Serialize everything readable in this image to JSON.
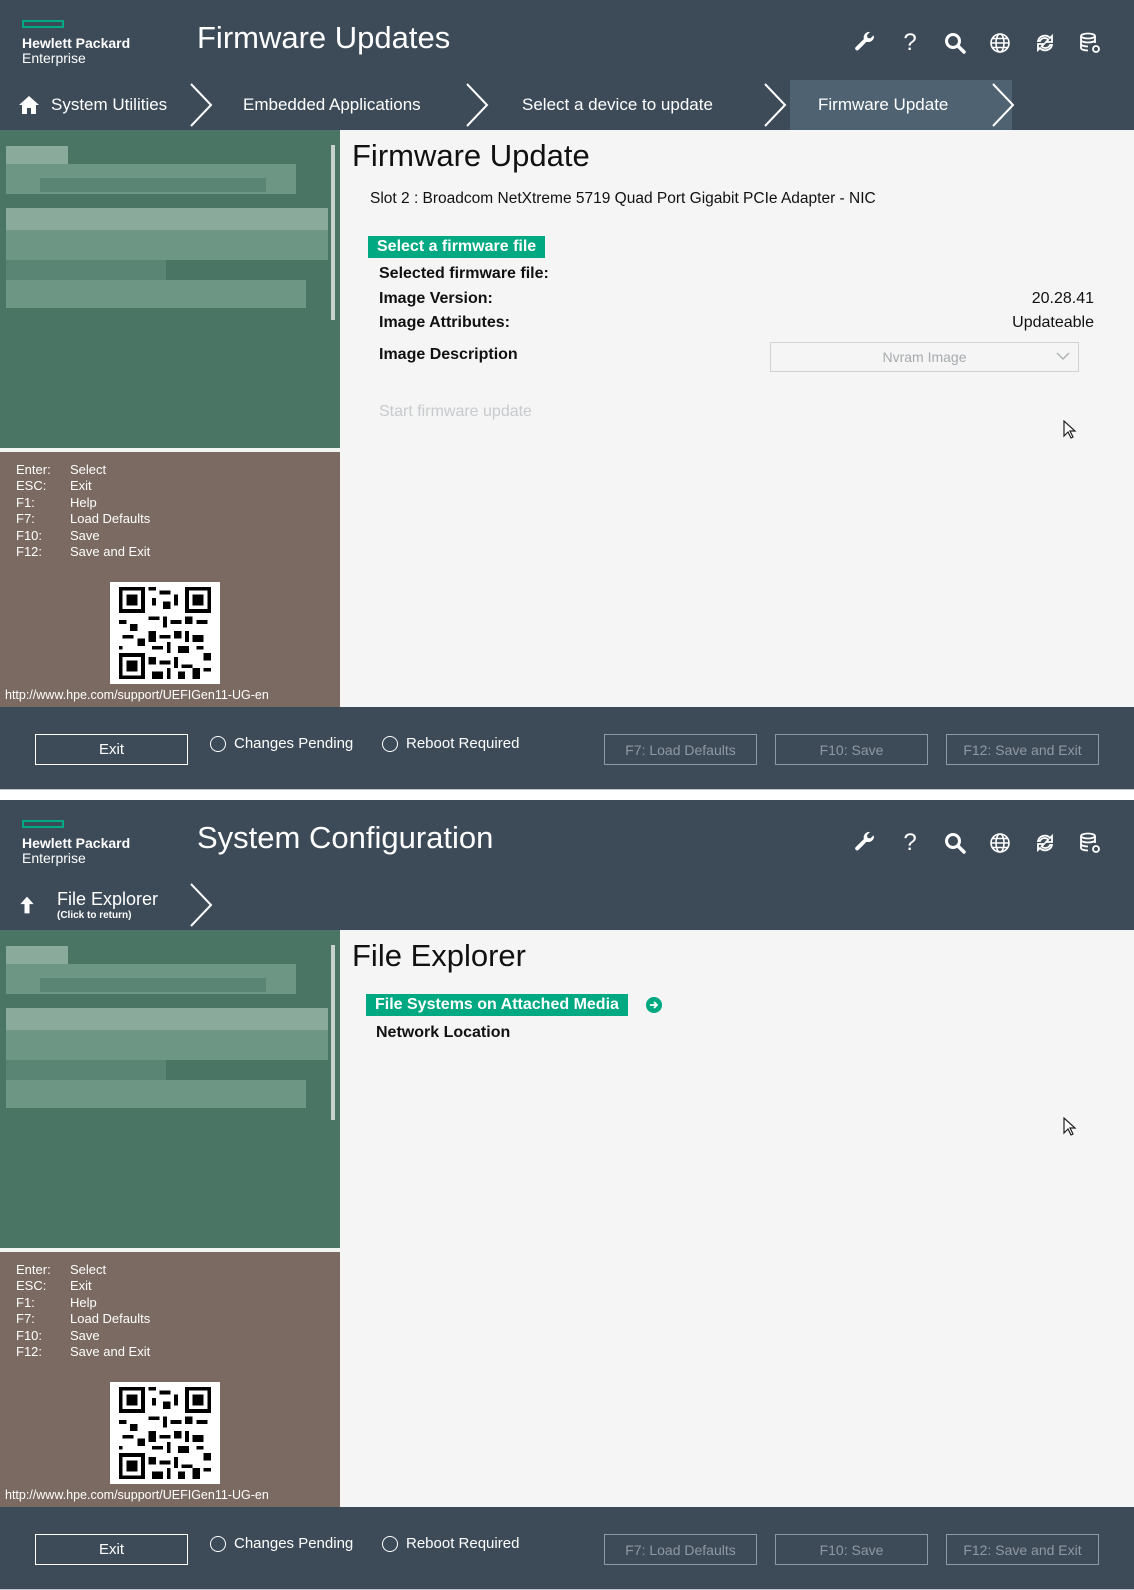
{
  "brand": {
    "line1": "Hewlett Packard",
    "line2": "Enterprise"
  },
  "colors": {
    "header": "#3d4a57",
    "accent": "#01a982",
    "sidebar_top": "#4a7564",
    "sidebar_bottom": "#7a6a61",
    "content_bg": "#f4f5f4"
  },
  "toolbar_icons": [
    "wrench-icon",
    "help-icon",
    "search-icon",
    "globe-icon",
    "refresh-icon",
    "database-icon"
  ],
  "help_panel": {
    "keys": [
      {
        "key": "Enter:",
        "action": "Select"
      },
      {
        "key": "ESC:",
        "action": "Exit"
      },
      {
        "key": "F1:",
        "action": "Help"
      },
      {
        "key": "F7:",
        "action": "Load Defaults"
      },
      {
        "key": "F10:",
        "action": "Save"
      },
      {
        "key": "F12:",
        "action": "Save and Exit"
      }
    ],
    "url": "http://www.hpe.com/support/UEFIGen11-UG-en"
  },
  "footer": {
    "exit": "Exit",
    "changes_pending": "Changes Pending",
    "reboot_required": "Reboot Required",
    "f7": "F7: Load Defaults",
    "f10": "F10: Save",
    "f12": "F12: Save and Exit"
  },
  "screen_firmware": {
    "app_title": "Firmware Updates",
    "breadcrumbs": [
      "System Utilities",
      "Embedded Applications",
      "Select a device to update",
      "Firmware Update"
    ],
    "page_title": "Firmware Update",
    "device": "Slot 2 : Broadcom NetXtreme 5719 Quad Port Gigabit PCIe Adapter - NIC",
    "select_file": "Select a firmware file",
    "selected_file_label": "Selected firmware file:",
    "image_version_label": "Image Version:",
    "image_version_value": "20.28.41",
    "image_attributes_label": "Image Attributes:",
    "image_attributes_value": "Updateable",
    "image_description_label": "Image Description",
    "image_description_value": "Nvram Image",
    "start_update": "Start firmware update"
  },
  "screen_explorer": {
    "app_title": "System Configuration",
    "breadcrumb": "File Explorer",
    "breadcrumb_hint": "(Click to return)",
    "page_title": "File Explorer",
    "items": [
      "File Systems on Attached Media",
      "Network Location"
    ]
  }
}
